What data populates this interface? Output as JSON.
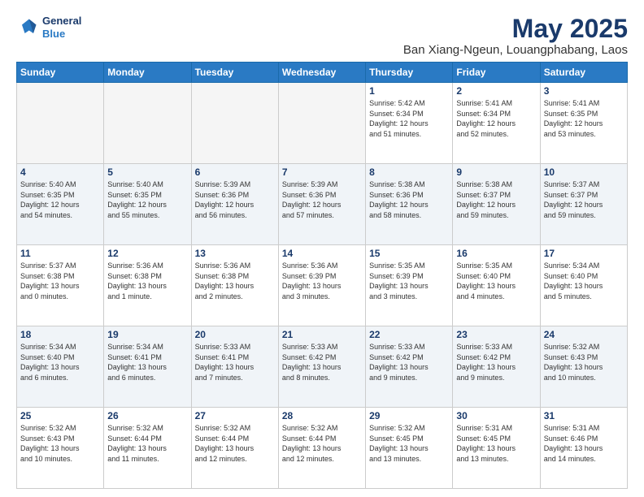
{
  "header": {
    "logo_line1": "General",
    "logo_line2": "Blue",
    "title": "May 2025",
    "subtitle": "Ban Xiang-Ngeun, Louangphabang, Laos"
  },
  "days_of_week": [
    "Sunday",
    "Monday",
    "Tuesday",
    "Wednesday",
    "Thursday",
    "Friday",
    "Saturday"
  ],
  "weeks": [
    [
      {
        "day": "",
        "data": ""
      },
      {
        "day": "",
        "data": ""
      },
      {
        "day": "",
        "data": ""
      },
      {
        "day": "",
        "data": ""
      },
      {
        "day": "1",
        "data": "Sunrise: 5:42 AM\nSunset: 6:34 PM\nDaylight: 12 hours\nand 51 minutes."
      },
      {
        "day": "2",
        "data": "Sunrise: 5:41 AM\nSunset: 6:34 PM\nDaylight: 12 hours\nand 52 minutes."
      },
      {
        "day": "3",
        "data": "Sunrise: 5:41 AM\nSunset: 6:35 PM\nDaylight: 12 hours\nand 53 minutes."
      }
    ],
    [
      {
        "day": "4",
        "data": "Sunrise: 5:40 AM\nSunset: 6:35 PM\nDaylight: 12 hours\nand 54 minutes."
      },
      {
        "day": "5",
        "data": "Sunrise: 5:40 AM\nSunset: 6:35 PM\nDaylight: 12 hours\nand 55 minutes."
      },
      {
        "day": "6",
        "data": "Sunrise: 5:39 AM\nSunset: 6:36 PM\nDaylight: 12 hours\nand 56 minutes."
      },
      {
        "day": "7",
        "data": "Sunrise: 5:39 AM\nSunset: 6:36 PM\nDaylight: 12 hours\nand 57 minutes."
      },
      {
        "day": "8",
        "data": "Sunrise: 5:38 AM\nSunset: 6:36 PM\nDaylight: 12 hours\nand 58 minutes."
      },
      {
        "day": "9",
        "data": "Sunrise: 5:38 AM\nSunset: 6:37 PM\nDaylight: 12 hours\nand 59 minutes."
      },
      {
        "day": "10",
        "data": "Sunrise: 5:37 AM\nSunset: 6:37 PM\nDaylight: 12 hours\nand 59 minutes."
      }
    ],
    [
      {
        "day": "11",
        "data": "Sunrise: 5:37 AM\nSunset: 6:38 PM\nDaylight: 13 hours\nand 0 minutes."
      },
      {
        "day": "12",
        "data": "Sunrise: 5:36 AM\nSunset: 6:38 PM\nDaylight: 13 hours\nand 1 minute."
      },
      {
        "day": "13",
        "data": "Sunrise: 5:36 AM\nSunset: 6:38 PM\nDaylight: 13 hours\nand 2 minutes."
      },
      {
        "day": "14",
        "data": "Sunrise: 5:36 AM\nSunset: 6:39 PM\nDaylight: 13 hours\nand 3 minutes."
      },
      {
        "day": "15",
        "data": "Sunrise: 5:35 AM\nSunset: 6:39 PM\nDaylight: 13 hours\nand 3 minutes."
      },
      {
        "day": "16",
        "data": "Sunrise: 5:35 AM\nSunset: 6:40 PM\nDaylight: 13 hours\nand 4 minutes."
      },
      {
        "day": "17",
        "data": "Sunrise: 5:34 AM\nSunset: 6:40 PM\nDaylight: 13 hours\nand 5 minutes."
      }
    ],
    [
      {
        "day": "18",
        "data": "Sunrise: 5:34 AM\nSunset: 6:40 PM\nDaylight: 13 hours\nand 6 minutes."
      },
      {
        "day": "19",
        "data": "Sunrise: 5:34 AM\nSunset: 6:41 PM\nDaylight: 13 hours\nand 6 minutes."
      },
      {
        "day": "20",
        "data": "Sunrise: 5:33 AM\nSunset: 6:41 PM\nDaylight: 13 hours\nand 7 minutes."
      },
      {
        "day": "21",
        "data": "Sunrise: 5:33 AM\nSunset: 6:42 PM\nDaylight: 13 hours\nand 8 minutes."
      },
      {
        "day": "22",
        "data": "Sunrise: 5:33 AM\nSunset: 6:42 PM\nDaylight: 13 hours\nand 9 minutes."
      },
      {
        "day": "23",
        "data": "Sunrise: 5:33 AM\nSunset: 6:42 PM\nDaylight: 13 hours\nand 9 minutes."
      },
      {
        "day": "24",
        "data": "Sunrise: 5:32 AM\nSunset: 6:43 PM\nDaylight: 13 hours\nand 10 minutes."
      }
    ],
    [
      {
        "day": "25",
        "data": "Sunrise: 5:32 AM\nSunset: 6:43 PM\nDaylight: 13 hours\nand 10 minutes."
      },
      {
        "day": "26",
        "data": "Sunrise: 5:32 AM\nSunset: 6:44 PM\nDaylight: 13 hours\nand 11 minutes."
      },
      {
        "day": "27",
        "data": "Sunrise: 5:32 AM\nSunset: 6:44 PM\nDaylight: 13 hours\nand 12 minutes."
      },
      {
        "day": "28",
        "data": "Sunrise: 5:32 AM\nSunset: 6:44 PM\nDaylight: 13 hours\nand 12 minutes."
      },
      {
        "day": "29",
        "data": "Sunrise: 5:32 AM\nSunset: 6:45 PM\nDaylight: 13 hours\nand 13 minutes."
      },
      {
        "day": "30",
        "data": "Sunrise: 5:31 AM\nSunset: 6:45 PM\nDaylight: 13 hours\nand 13 minutes."
      },
      {
        "day": "31",
        "data": "Sunrise: 5:31 AM\nSunset: 6:46 PM\nDaylight: 13 hours\nand 14 minutes."
      }
    ]
  ]
}
